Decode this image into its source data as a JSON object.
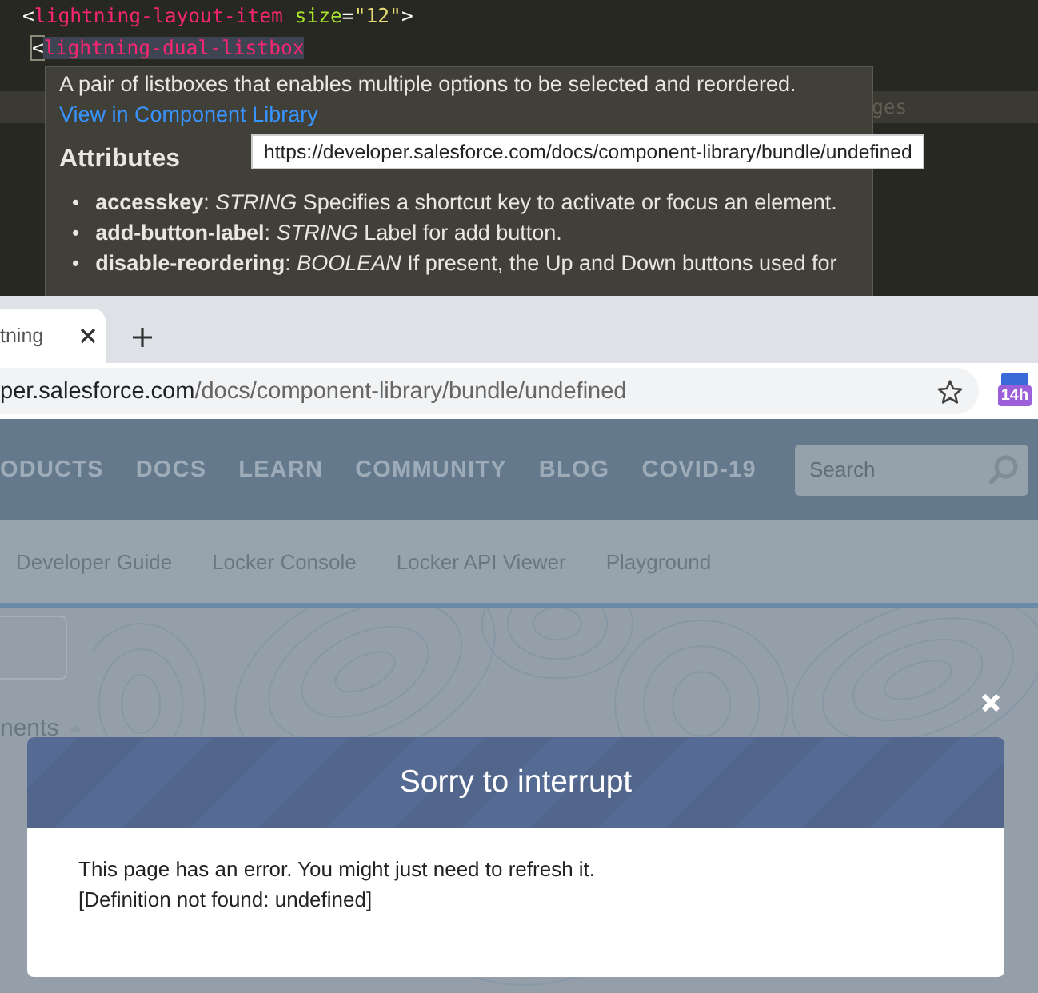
{
  "editor": {
    "lines": [
      {
        "tokens": [
          {
            "kind": "punct",
            "text": "<"
          },
          {
            "kind": "tag",
            "text": "lightning-layout-item"
          },
          {
            "kind": "attr",
            "text": " size"
          },
          {
            "kind": "punct",
            "text": "="
          },
          {
            "kind": "string",
            "text": "\"12\""
          },
          {
            "kind": "punct",
            "text": ">"
          }
        ]
      },
      {
        "tokens": [
          {
            "kind": "match",
            "text": "<"
          },
          {
            "kind": "tag",
            "text": "lightning-dual-listbox"
          }
        ]
      },
      {
        "tokens": [
          {
            "kind": "faded",
            "text": "ges"
          }
        ]
      }
    ]
  },
  "hover_doc": {
    "description": "A pair of listboxes that enables multiple options to be selected and reordered.",
    "link": "View in Component Library",
    "heading": "Attributes",
    "attributes": [
      {
        "marker": "•",
        "text": "**accesskey**: *STRING* Specifies a shortcut key to activate or focus an element."
      },
      {
        "marker": "•",
        "text": "**add-button-label**: *STRING* Label for add button."
      },
      {
        "marker": "•",
        "text": "**disable-reordering**: *BOOLEAN* If present, the Up and Down buttons used for"
      }
    ]
  },
  "link_tooltip": "https://developer.salesforce.com/docs/component-library/bundle/undefined",
  "browser": {
    "tab": {
      "title": "tning"
    },
    "address": {
      "host": "per.salesforce.com",
      "path": "/docs/component-library/bundle/undefined"
    },
    "extension_badge": "14h"
  },
  "site": {
    "nav": [
      "ODUCTS",
      "DOCS",
      "LEARN",
      "COMMUNITY",
      "BLOG",
      "COVID-19"
    ],
    "search": {
      "placeholder": "Search"
    },
    "subnav": [
      "Developer Guide",
      "Locker Console",
      "Locker API Viewer",
      "Playground"
    ],
    "section_label": "nents"
  },
  "modal": {
    "title": "Sorry to interrupt",
    "message": [
      "This page has an error. You might just need to refresh it.",
      "[Definition not found: undefined]"
    ]
  }
}
